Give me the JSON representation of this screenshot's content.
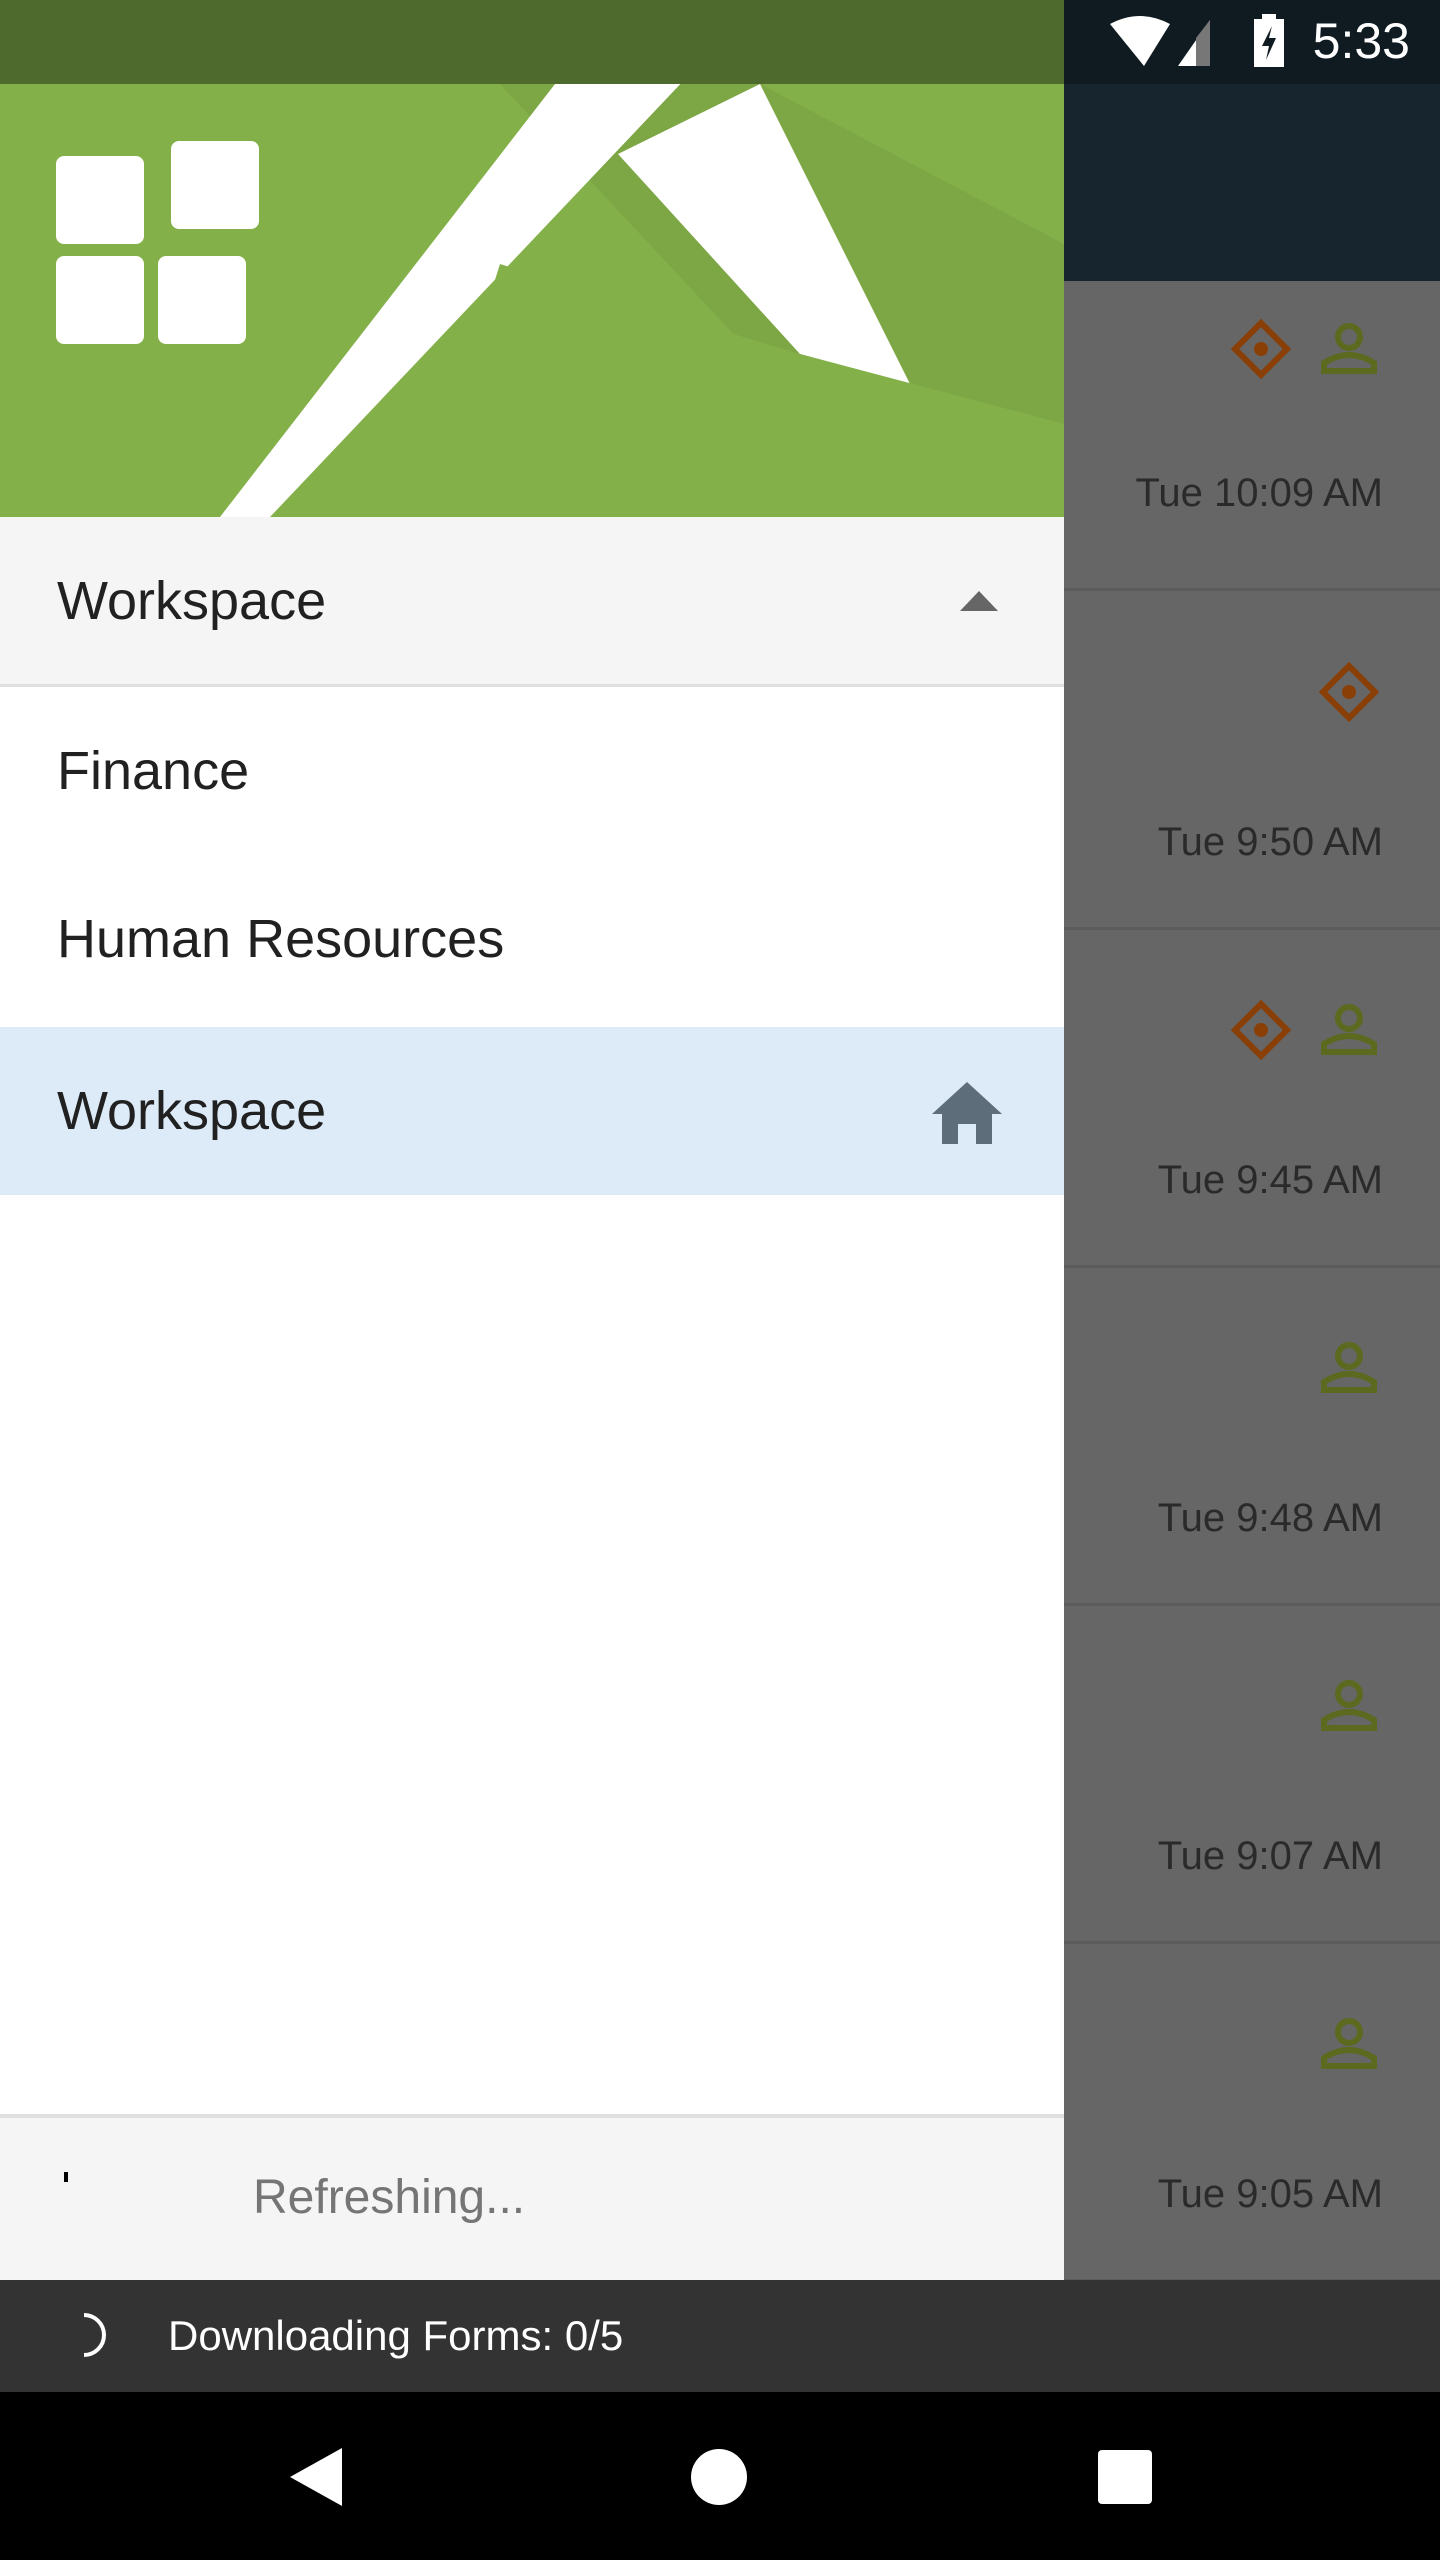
{
  "status_bar": {
    "time": "5:33",
    "icons": [
      "wifi-icon",
      "signal-icon",
      "battery-charging-icon"
    ]
  },
  "drawer": {
    "selector": {
      "label": "Workspace",
      "icon": "caret-up-icon"
    },
    "items": [
      {
        "label": "Finance"
      },
      {
        "label": "Human Resources"
      },
      {
        "label": "Workspace",
        "selected": true,
        "icon": "home-icon"
      }
    ],
    "footer": {
      "status": "Refreshing..."
    }
  },
  "list": {
    "rows": [
      {
        "time": "Tue 10:09 AM",
        "icons": [
          "diamond-icon",
          "person-icon"
        ]
      },
      {
        "time": "Tue 9:50 AM",
        "icons": [
          "diamond-icon"
        ]
      },
      {
        "time": "Tue 9:45 AM",
        "icons": [
          "diamond-icon",
          "person-icon"
        ]
      },
      {
        "time": "Tue 9:48 AM",
        "icons": [
          "person-icon"
        ]
      },
      {
        "time": "Tue 9:07 AM",
        "icons": [
          "person-icon"
        ]
      },
      {
        "time": "Tue 9:05 AM",
        "icons": [
          "person-icon"
        ]
      }
    ]
  },
  "snackbar": {
    "text": "Downloading Forms: 0/5"
  },
  "colors": {
    "brand_green": "#84b04a",
    "selected_bg": "#ddebf9",
    "diamond": "#8a3f06",
    "person": "#5b6a1e"
  }
}
